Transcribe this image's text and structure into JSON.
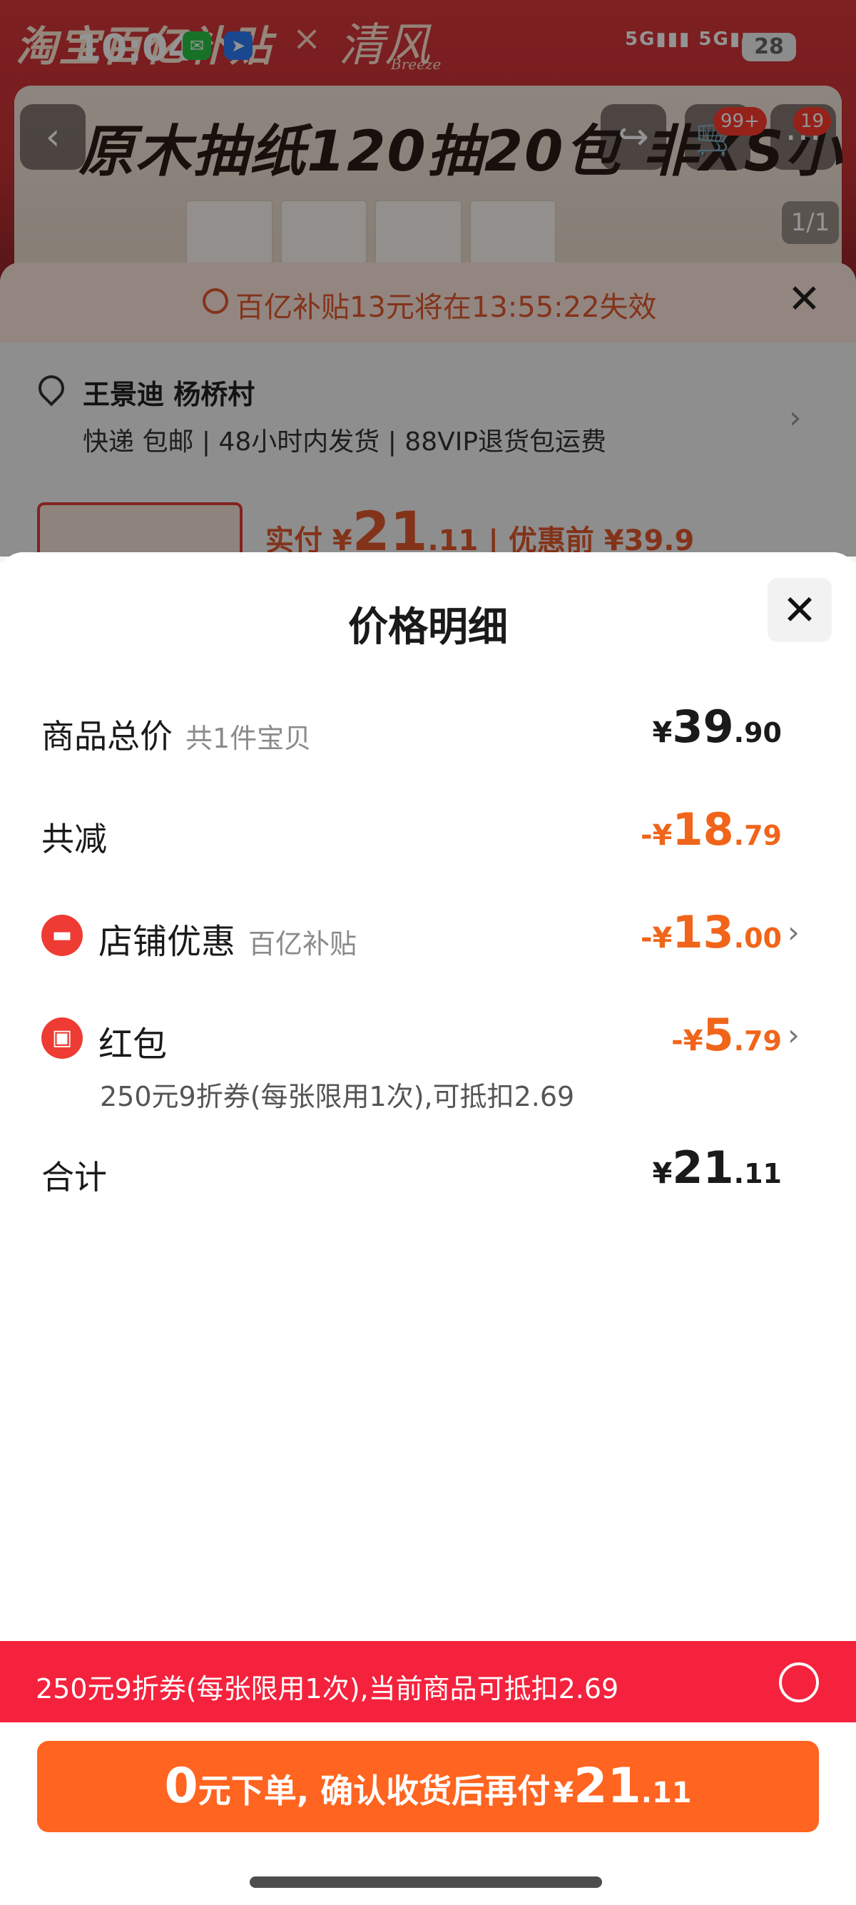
{
  "status_bar": {
    "time": "10:04",
    "signal_text": "5G▮▮▮ 5G▮▮▮",
    "battery": "28"
  },
  "background": {
    "hero_brand": "淘宝百亿补贴",
    "hero_cross": "×",
    "hero_partner": "清风",
    "hero_partner_en": "Breeze",
    "product_title": "原木抽纸120抽20包 非XS小",
    "image_pager": "1/1",
    "cart_badge": "99+",
    "more_badge": "19",
    "subsidy_notice": "百亿补贴13元将在13:55:22失效",
    "address_name": "王景迪 杨桥村",
    "address_meta": "快递 包邮 | 48小时内发货 | 88VIP退货包运费",
    "pay_prefix": "实付 ¥",
    "pay_amount": "21",
    "pay_decimal": ".11",
    "pay_before": "| 优惠前 ¥39.9"
  },
  "sheet": {
    "title": "价格明细",
    "rows": {
      "total": {
        "label": "商品总价",
        "sub": "共1件宝贝",
        "currency": "¥",
        "int": "39",
        "dec": ".90"
      },
      "reduction": {
        "label": "共减",
        "currency": "-¥",
        "int": "18",
        "dec": ".79"
      },
      "store": {
        "label": "店铺优惠",
        "sub": "百亿补贴",
        "currency": "-¥",
        "int": "13",
        "dec": ".00"
      },
      "redpacket": {
        "label": "红包",
        "desc": "250元9折券(每张限用1次),可抵扣2.69",
        "currency": "-¥",
        "int": "5",
        "dec": ".79"
      },
      "sum": {
        "label": "合计",
        "currency": "¥",
        "int": "21",
        "dec": ".11"
      }
    }
  },
  "promo": {
    "text": "250元9折券(每张限用1次),当前商品可抵扣2.69"
  },
  "order_button": {
    "zero": "0",
    "text": "元下单, 确认收货后再付",
    "currency": "¥",
    "int": "21",
    "dec": ".11"
  },
  "colors": {
    "accent_orange": "#ff6420",
    "promo_red": "#f5223d",
    "discount_orange": "#f0651a"
  }
}
